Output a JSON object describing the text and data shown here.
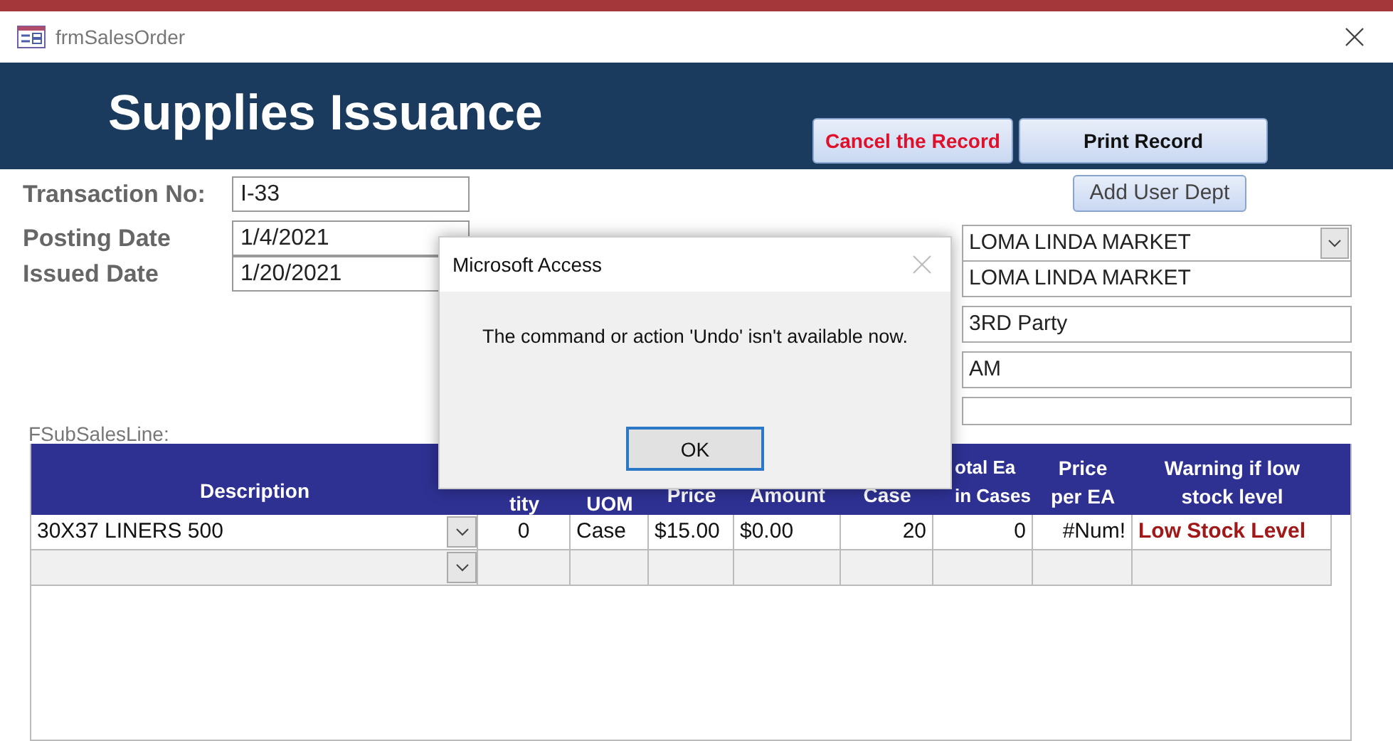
{
  "window": {
    "title": "frmSalesOrder"
  },
  "header": {
    "title": "Supplies Issuance",
    "buttons": [
      {
        "label": "Cancel the Record",
        "kind": "danger"
      },
      {
        "label": "Print Record",
        "kind": "normal"
      }
    ]
  },
  "fields": [
    {
      "label": "Transaction No:",
      "value": "I-33"
    },
    {
      "label": "Posting Date",
      "value": "1/4/2021"
    },
    {
      "label": "Issued Date",
      "value": "1/20/2021"
    }
  ],
  "add_button": {
    "label": "Add User Dept"
  },
  "right_fields": [
    {
      "value": "LOMA LINDA MARKET",
      "kind": "combo"
    },
    {
      "value": "LOMA LINDA MARKET",
      "kind": "text"
    },
    {
      "value": "3RD Party",
      "kind": "text"
    },
    {
      "value": "AM",
      "kind": "text"
    },
    {
      "kind": "text"
    }
  ],
  "subform": {
    "label": "FSubSalesLine:",
    "columns": [
      {
        "heading": "Description",
        "kind": "combo"
      },
      {
        "heading": "tity",
        "kind": "center"
      },
      {
        "heading": "UOM",
        "kind": "left"
      },
      {
        "heading": "Price",
        "kind": "left"
      },
      {
        "heading": "Amount",
        "kind": "left"
      },
      {
        "heading": "Case",
        "kind": "right"
      },
      {
        "heading": "otal Ea in Cases",
        "kind": "right"
      },
      {
        "heading": "Price per EA",
        "kind": "right"
      },
      {
        "heading": "Warning if low stock level",
        "kind": "warning"
      }
    ],
    "rows": [
      {
        "kind": "record",
        "cells": [
          "30X37 LINERS 500",
          "0",
          "Case",
          "$15.00",
          "$0.00",
          "20",
          "0",
          "#Num!",
          "Low Stock Level"
        ]
      },
      {
        "kind": "new"
      }
    ]
  },
  "dialog": {
    "title": "Microsoft Access",
    "message": "The command or action 'Undo' isn't available now.",
    "button": "OK"
  }
}
